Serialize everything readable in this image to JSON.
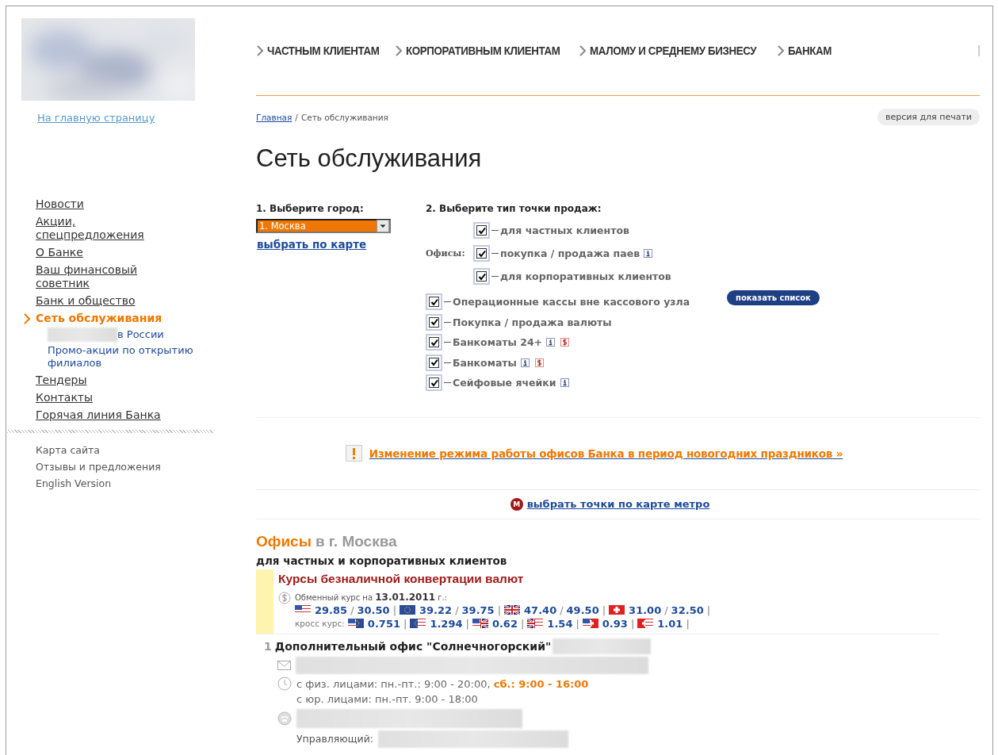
{
  "sidebar": {
    "logo": {
      "kind": "picture"
    },
    "home_link": "На главную страницу",
    "menu": [
      {
        "label": "Новости",
        "selected": false
      },
      {
        "label": "Акции, спецпредложения",
        "selected": false
      },
      {
        "label": "О Банке",
        "selected": false
      },
      {
        "label": "Ваш финансовый советник",
        "selected": false
      },
      {
        "label": "Банк и общество",
        "selected": false
      },
      {
        "label": "Сеть обслуживания",
        "selected": true,
        "children": [
          {
            "label": "в России",
            "redacted_prefix": true
          },
          {
            "label": "Промо-акции по открытию филиалов",
            "redacted_prefix": false
          }
        ]
      },
      {
        "label": "Тендеры",
        "selected": false
      },
      {
        "label": "Контакты",
        "selected": false
      },
      {
        "label": "Горячая линия Банка",
        "selected": false
      }
    ],
    "footer_links": [
      "Карта сайта",
      "Отзывы и предложения",
      "English Version"
    ]
  },
  "top_nav": [
    "ЧАСТНЫМ КЛИЕНТАМ",
    "КОРПОРАТИВНЫМ КЛИЕНТАМ",
    "МАЛОМУ И СРЕДНЕМУ БИЗНЕСУ",
    "БАНКАМ"
  ],
  "breadcrumbs": [
    {
      "label": "Главная",
      "link": true
    },
    {
      "label": "Сеть обслуживания",
      "link": false
    }
  ],
  "breadcrumb_separator": "/",
  "print_button": "версия для печати",
  "title": "Сеть обслуживания",
  "city": {
    "label": "1. Выберите город:",
    "value": "1. Москва",
    "map_link": "выбрать по карте"
  },
  "types": {
    "label": "2. Выберите тип точки продаж:",
    "offices_label": "Офисы:",
    "offices": [
      {
        "label": "для частных клиентов",
        "checked": true,
        "info": false,
        "dollar": false
      },
      {
        "label": "покупка / продажа паев",
        "checked": true,
        "info": true,
        "dollar": false
      },
      {
        "label": "для корпоративных клиентов",
        "checked": true,
        "info": false,
        "dollar": false
      }
    ],
    "others": [
      {
        "label": "Операционные кассы вне кассового узла",
        "checked": true,
        "info": false,
        "dollar": false
      },
      {
        "label": "Покупка / продажа валюты",
        "checked": true,
        "info": false,
        "dollar": false
      },
      {
        "label": "Банкоматы 24+",
        "checked": true,
        "info": true,
        "dollar": true
      },
      {
        "label": "Банкоматы",
        "checked": true,
        "info": true,
        "dollar": true
      },
      {
        "label": "Сейфовые ячейки",
        "checked": true,
        "info": true,
        "dollar": false
      }
    ],
    "button": "показать список"
  },
  "notice": "Изменение режима работы офисов Банка в период новогодних праздников »",
  "metro": {
    "badge": "M",
    "link": "выбрать точки по карте метро"
  },
  "offices": {
    "heading": "Офисы",
    "city": "в г. Москва",
    "subtitle": "для частных и корпоративных клиентов",
    "rates": {
      "title": "Курсы безналичной конвертации валют",
      "date_text": "Обменный курс на **13.01.2011** г.:",
      "pair_separator": "/",
      "item_separator": "|",
      "cross_label": "кросс курс:",
      "rows": [
        {
          "kind": "us",
          "buy": "29.85",
          "sell": "30.50"
        },
        {
          "kind": "eu",
          "buy": "39.22",
          "sell": "39.75"
        },
        {
          "kind": "gb",
          "buy": "47.40",
          "sell": "49.50"
        },
        {
          "kind": "ch",
          "buy": "31.00",
          "sell": "32.50"
        }
      ],
      "cross": [
        {
          "kind": "us-eu",
          "value": "0.751"
        },
        {
          "kind": "eu-us",
          "value": "1.294"
        },
        {
          "kind": "us-gb",
          "value": "0.62"
        },
        {
          "kind": "gb-us",
          "value": "1.54"
        },
        {
          "kind": "us-ch",
          "value": "0.93"
        },
        {
          "kind": "ch-us",
          "value": "1.01"
        }
      ]
    },
    "list": [
      {
        "number": "1",
        "name": "Дополнительный офис \"Солнечногорский\"",
        "hours": [
          "с физ. лицами: пн.-пт.: 9:00 - 20:00, **сб.: 9:00 - 16:00**",
          "с юр. лицами: пн.-пт. 9:00 - 18:00"
        ],
        "manager_label": "Управляющий:"
      }
    ]
  }
}
